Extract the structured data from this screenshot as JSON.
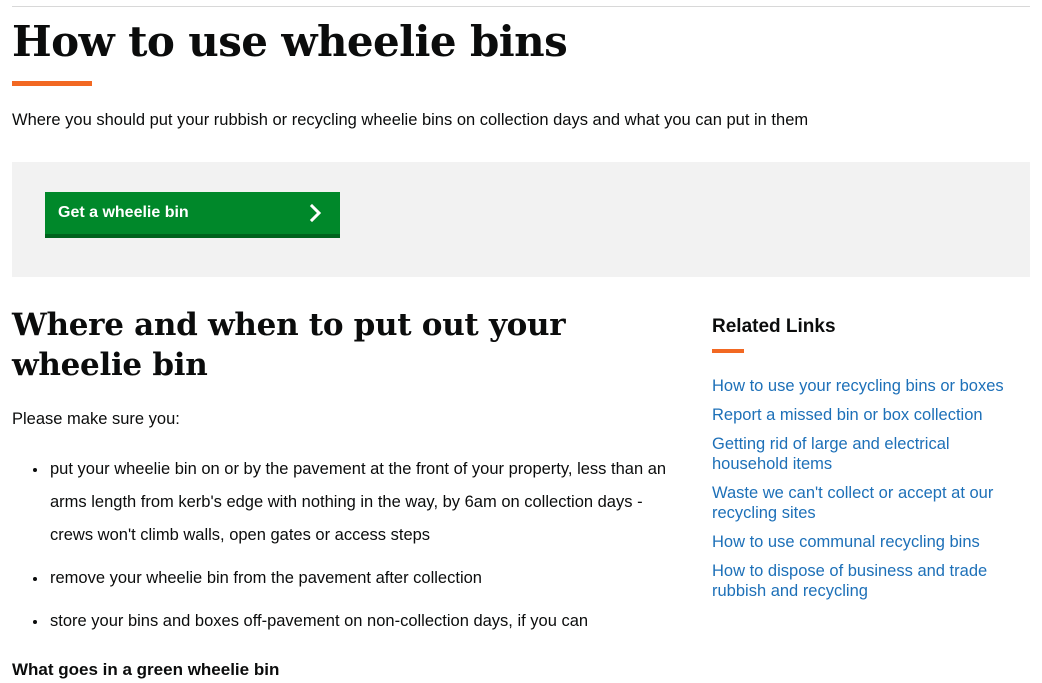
{
  "page": {
    "title": "How to use wheelie bins",
    "subtitle": "Where you should put your rubbish or recycling wheelie bins on collection days and what you can put in them"
  },
  "theme": {
    "accent_orange": "#f26822",
    "button_green": "#00882a",
    "button_green_shadow": "#00631d",
    "link_blue": "#1d70b8",
    "panel_grey": "#f2f2f2",
    "text_black": "#0b0c0c",
    "rule_grey": "#d8d8d8"
  },
  "cta": {
    "button_label": "Get a wheelie bin",
    "chevron_icon": "chevron-right-icon"
  },
  "main": {
    "section_heading": "Where and when to put out your wheelie bin",
    "intro": "Please make sure you:",
    "bullets": [
      "put your wheelie bin on or by the pavement at the front of your property, less than an arms length from kerb's edge with nothing in the way, by 6am on collection days - crews won't climb walls, open gates or access steps",
      "remove your wheelie bin from the pavement after collection",
      "store your bins and boxes off-pavement on non-collection days, if you can"
    ],
    "subsection_heading": "What goes in a green wheelie bin"
  },
  "sidebar": {
    "heading": "Related Links",
    "links": [
      "How to use your recycling bins or boxes",
      "Report a missed bin or box collection",
      "Getting rid of large and electrical household items",
      "Waste we can't collect or accept at our recycling sites",
      "How to use communal recycling bins",
      "How to dispose of business and trade rubbish and recycling"
    ]
  }
}
